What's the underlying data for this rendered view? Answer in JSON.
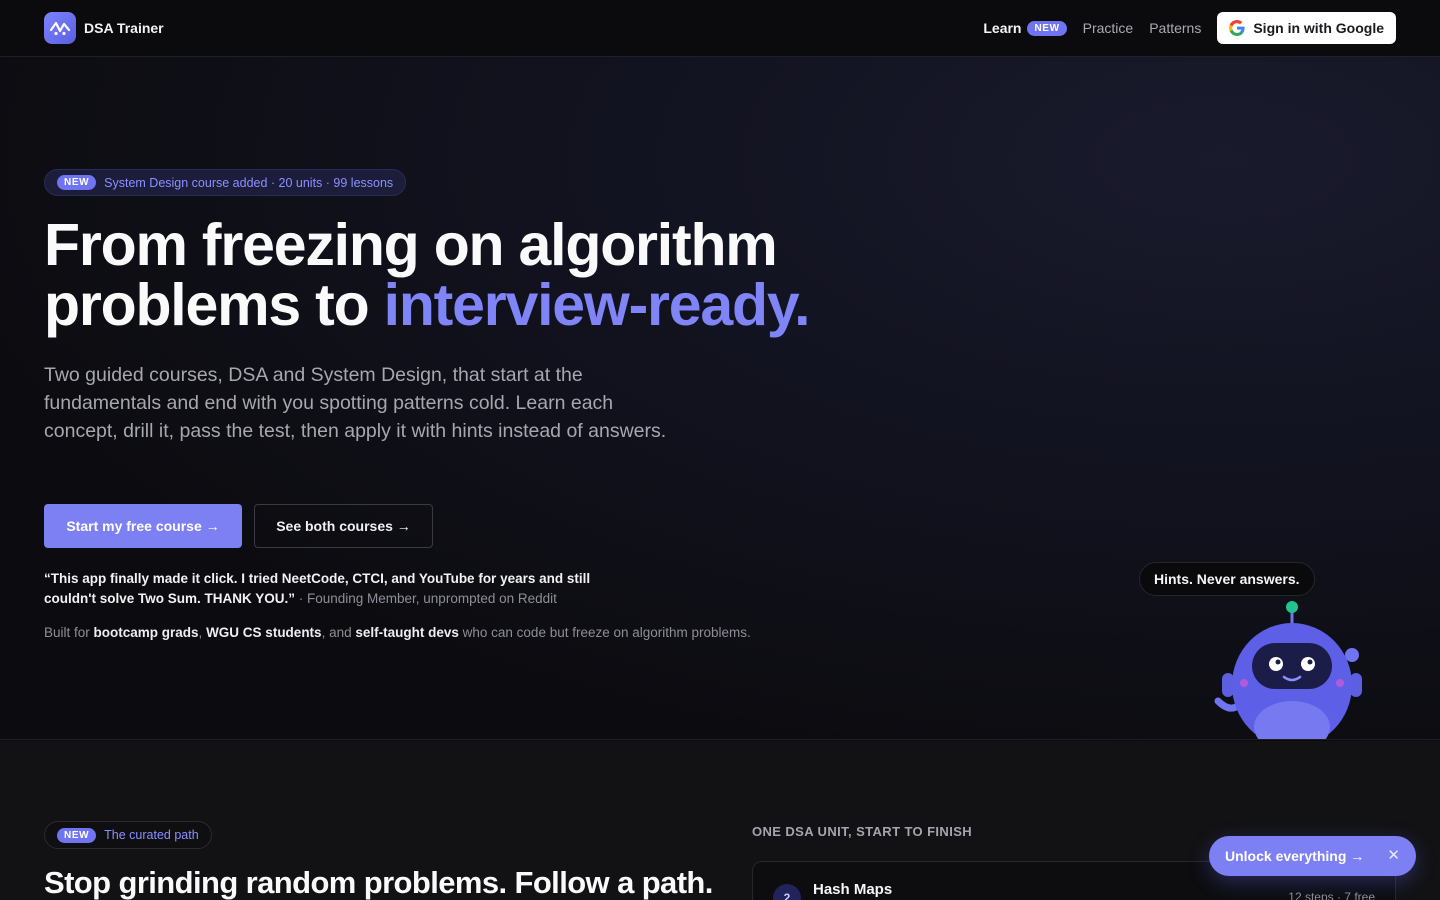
{
  "nav": {
    "brand": "DSA Trainer",
    "links": {
      "learn": "Learn",
      "learn_badge": "NEW",
      "practice": "Practice",
      "patterns": "Patterns"
    },
    "signin": "Sign in with Google"
  },
  "hero": {
    "announce_badge": "NEW",
    "announce_text": "System Design course added · 20 units · 99 lessons",
    "title_line1": "From freezing on algorithm",
    "title_line2a": "problems to ",
    "title_line2b": "interview-ready.",
    "subtitle": "Two guided courses, DSA and System Design, that start at the fundamentals and end with you spotting patterns cold. Learn each concept, drill it, pass the test, then apply it with hints instead of answers.",
    "cta_primary": "Start my free course →",
    "cta_secondary": "See both courses →",
    "quote": "“This app finally made it click. I tried NeetCode, CTCI, and YouTube for years and still couldn't solve Two Sum. THANK YOU.”",
    "quote_attr": " · Founding Member, unprompted on Reddit",
    "built_prefix": "Built for ",
    "audience": [
      "bootcamp grads",
      "WGU CS students",
      "self-taught devs"
    ],
    "built_sep1": ", ",
    "built_sep2": ", and ",
    "built_suffix": " who can code but freeze on algorithm problems.",
    "speech": "Hints. Never answers."
  },
  "section2": {
    "badge": "NEW",
    "badge_text": "The curated path",
    "title": "Stop grinding random problems. Follow a path.",
    "eyebrow": "ONE DSA UNIT, START TO FINISH",
    "unit_number": "2",
    "unit_name": "Hash Maps",
    "unit_meta": "12 steps · 7 free"
  },
  "floating": {
    "unlock": "Unlock everything →",
    "close": "✕"
  },
  "colors": {
    "accent": "#7c80f2",
    "background": "#0b0b0d"
  }
}
